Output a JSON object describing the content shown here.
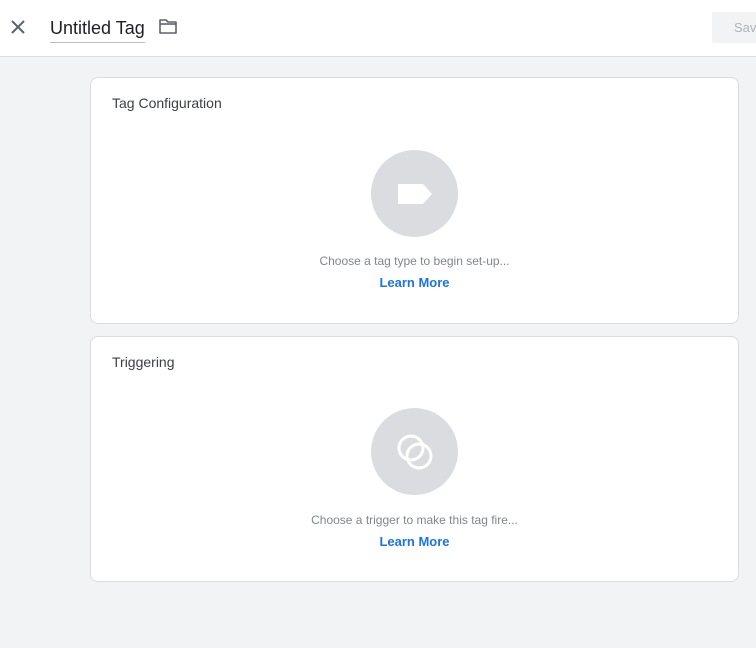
{
  "header": {
    "tag_name": "Untitled Tag",
    "save_label": "Save"
  },
  "tag_configuration": {
    "title": "Tag Configuration",
    "prompt": "Choose a tag type to begin set-up...",
    "learn_more": "Learn More"
  },
  "triggering": {
    "title": "Triggering",
    "prompt": "Choose a trigger to make this tag fire...",
    "learn_more": "Learn More"
  },
  "colors": {
    "background": "#f1f3f4",
    "link": "#1a73e8",
    "icon_circle": "#dadce0"
  }
}
